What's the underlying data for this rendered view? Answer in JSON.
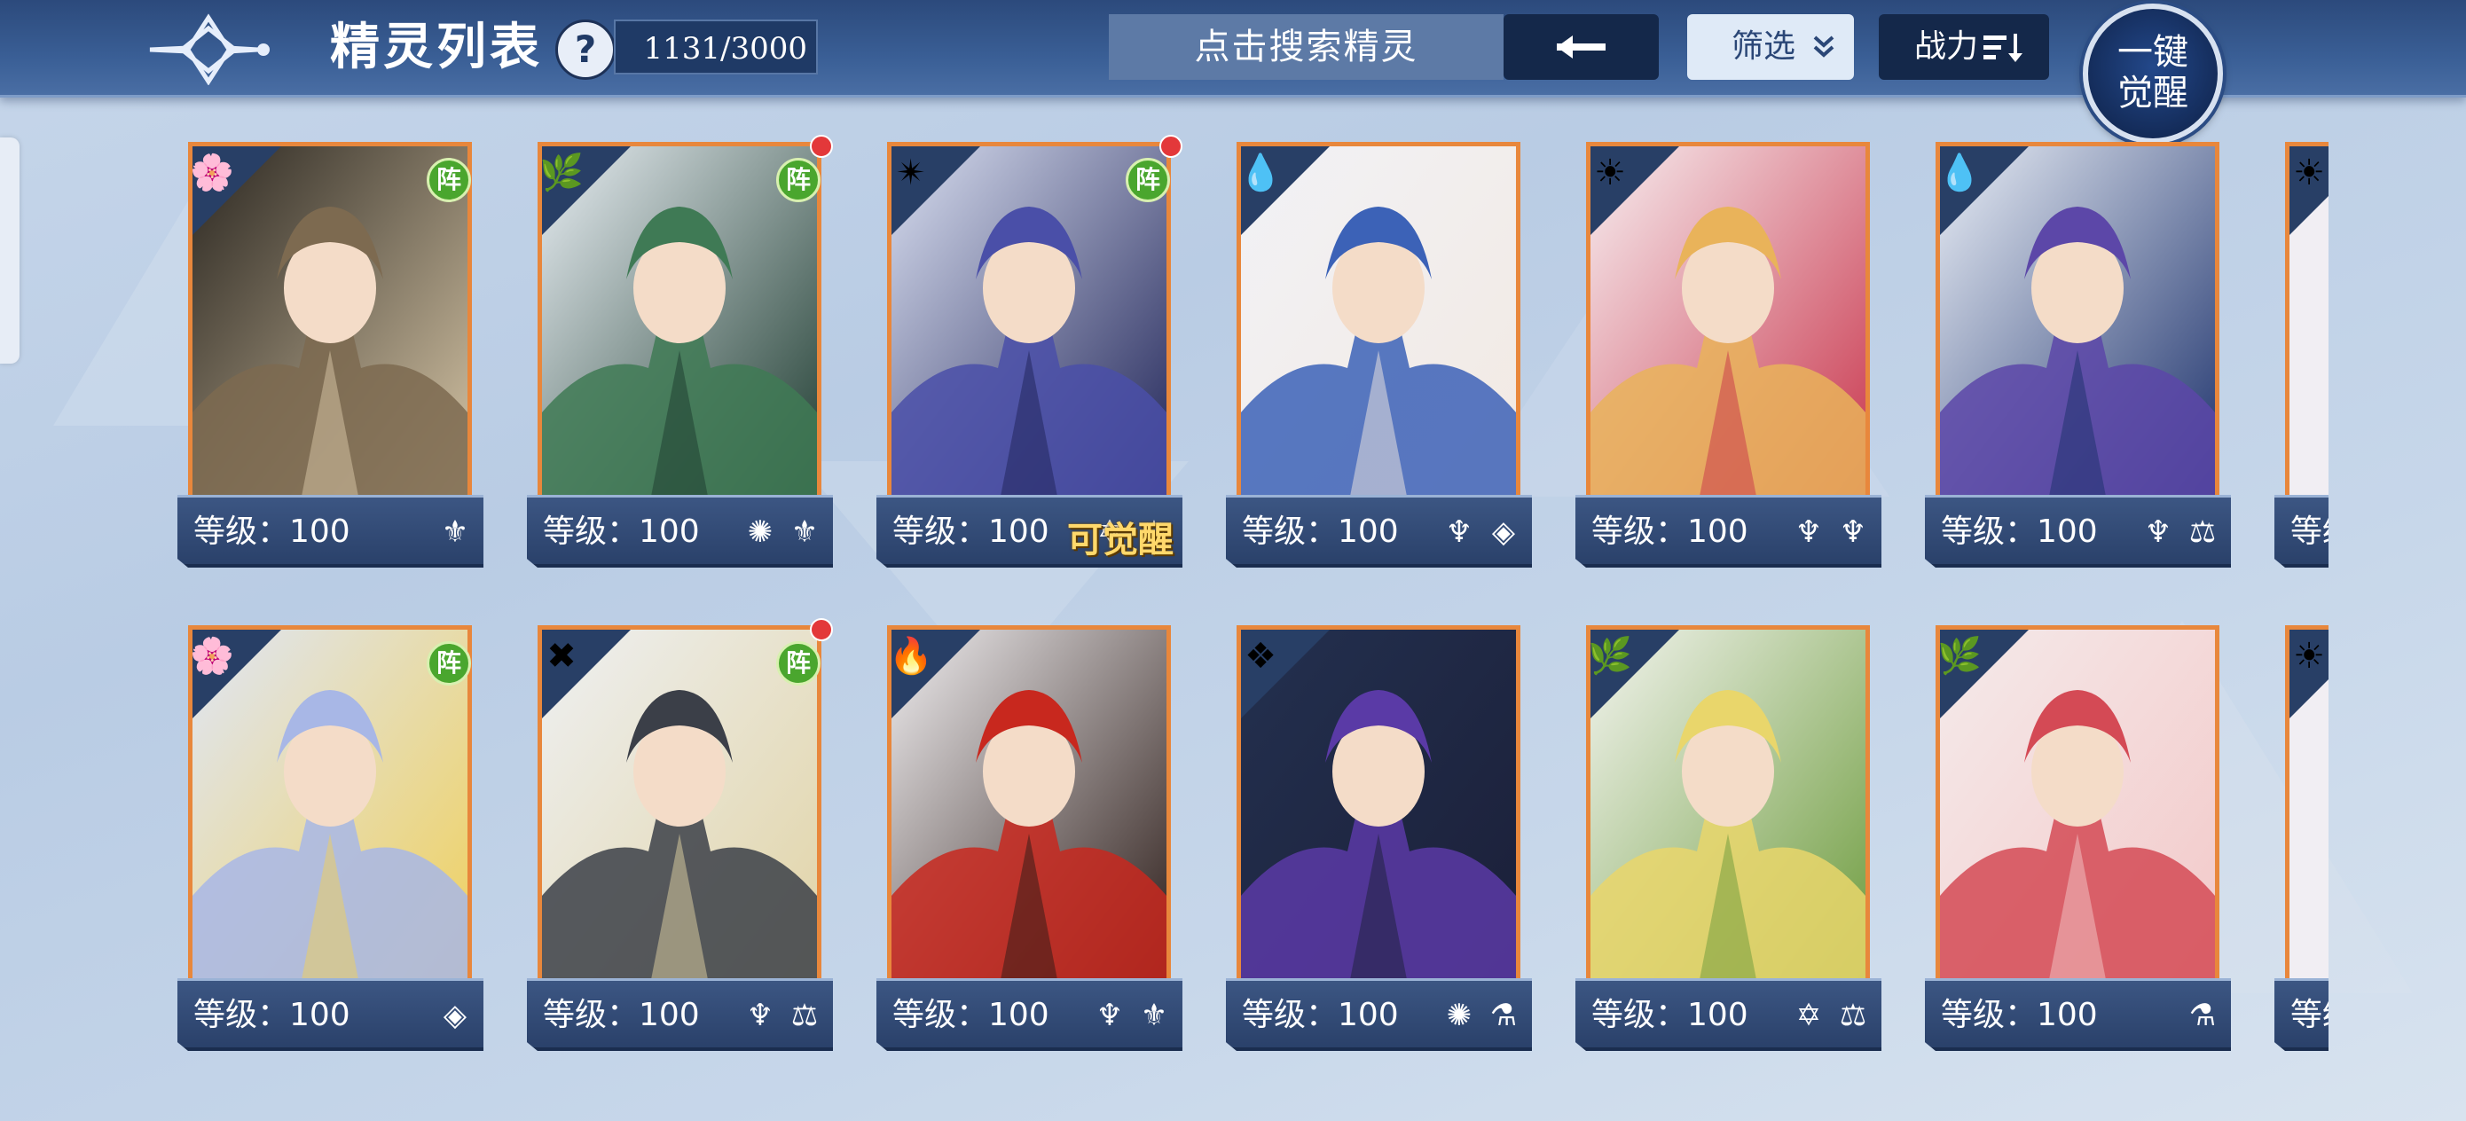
{
  "header": {
    "title": "精灵列表",
    "help": "?",
    "count": "1131/3000",
    "search_placeholder": "点击搜索精灵",
    "back_arrow": "←",
    "filter_label": "筛选",
    "sort_label": "战力",
    "awaken_all_line1": "一键",
    "awaken_all_line2": "觉醒"
  },
  "colors": {
    "topbar": "#3a5f96",
    "frame_orange": "#e8873c",
    "formation_green": "#4aa62e",
    "notify_red": "#e3383a"
  },
  "cards": [
    {
      "level": "等级：100",
      "element": "🌸",
      "formation": "阵",
      "notify": false,
      "awake": "",
      "classes": [
        "⚜"
      ],
      "bg": "#2a2620,#7d6a50,#d9c8a8"
    },
    {
      "level": "等级：100",
      "element": "🌿",
      "formation": "阵",
      "notify": true,
      "awake": "",
      "classes": [
        "✺",
        "⚜"
      ],
      "bg": "#e8eef3,#3f7a55,#1c3a2e"
    },
    {
      "level": "等级：100",
      "element": "✴",
      "formation": "阵",
      "notify": true,
      "awake": "可觉醒",
      "classes": [
        "✡",
        "⚖"
      ],
      "bg": "#d8def0,#4a4fa8,#1e2256"
    },
    {
      "level": "等级：100",
      "element": "💧",
      "formation": "",
      "notify": false,
      "awake": "",
      "classes": [
        "♆",
        "◈"
      ],
      "bg": "#f1f2f6,#3c62b7,#f3e9e2"
    },
    {
      "level": "等级：100",
      "element": "☀",
      "formation": "",
      "notify": false,
      "awake": "",
      "classes": [
        "♆",
        "♆"
      ],
      "bg": "#f7eef0,#e9b35a,#c8334a"
    },
    {
      "level": "等级：100",
      "element": "💧",
      "formation": "",
      "notify": false,
      "awake": "",
      "classes": [
        "♆",
        "⚖"
      ],
      "bg": "#e9eef6,#5c47a8,#1a2f6a"
    },
    {
      "level": "等级：100",
      "element": "🌸",
      "formation": "阵",
      "notify": false,
      "awake": "",
      "classes": [
        "◈"
      ],
      "bg": "#dfe6f6,#a8b7e6,#f0d05a"
    },
    {
      "level": "等级：100",
      "element": "✖",
      "formation": "阵",
      "notify": true,
      "awake": "",
      "classes": [
        "♆",
        "⚖"
      ],
      "bg": "#eef0f2,#3b3f48,#e1d3a4"
    },
    {
      "level": "等级：100",
      "element": "🔥",
      "formation": "",
      "notify": false,
      "awake": "",
      "classes": [
        "♆",
        "⚜"
      ],
      "bg": "#f0eef0,#c8281e,#2a1a16"
    },
    {
      "level": "等级：100",
      "element": "❖",
      "formation": "",
      "notify": false,
      "awake": "",
      "classes": [
        "✺",
        "⚗"
      ],
      "bg": "#23304f,#5a3aa6,#1b1f38"
    },
    {
      "level": "等级：100",
      "element": "🌿",
      "formation": "",
      "notify": false,
      "awake": "",
      "classes": [
        "✡",
        "⚖"
      ],
      "bg": "#f3f4ef,#e9d66b,#6b9a3a"
    },
    {
      "level": "等级：100",
      "element": "🌿",
      "formation": "",
      "notify": false,
      "awake": "",
      "classes": [
        "⚗"
      ],
      "bg": "#f4eaea,#d44a55,#f3c8c8"
    }
  ],
  "partial_cards": [
    {
      "level": "等级",
      "element": "☀"
    },
    {
      "level": "等级",
      "element": "☀"
    }
  ]
}
